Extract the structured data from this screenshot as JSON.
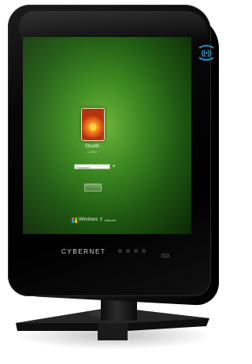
{
  "device": {
    "brand_logo": "CYBERNET",
    "rfid_icon": "rfid-contactless-icon",
    "rfid_label": "((•))"
  },
  "screen": {
    "login": {
      "user_name": "Stealth",
      "user_status": "Locked",
      "password_placeholder": "Password",
      "submit_icon": "arrow-right-icon",
      "submit_glyph": "▸",
      "switch_user_label": ""
    },
    "branding": {
      "os_name": "Windows",
      "os_version": "7",
      "os_edition": "Ultimate"
    }
  },
  "colors": {
    "screen_green": "#3d8a22",
    "bezel_black": "#0a0a0a",
    "rfid_blue": "#2c8bc4",
    "win_red": "#f25022",
    "win_green": "#7fba00",
    "win_blue": "#00a4ef",
    "win_yellow": "#ffb900"
  }
}
